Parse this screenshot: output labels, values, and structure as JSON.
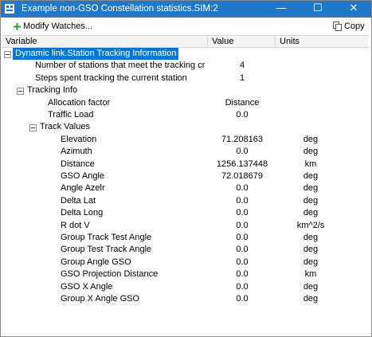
{
  "window": {
    "title": "Example non-GSO Constellation statistics.SIM:2",
    "minimize_glyph": "—",
    "maximize_glyph": "☐",
    "close_glyph": "✕"
  },
  "toolbar": {
    "modify_label": "Modify Watches...",
    "copy_label": "Copy"
  },
  "columns": {
    "variable": "Variable",
    "value": "Value",
    "units": "Units"
  },
  "colors": {
    "titlebar": "#1f79c8",
    "selection": "#0078d7",
    "add_icon": "#2e9b3c"
  },
  "rows": [
    {
      "depth": 0,
      "toggle": true,
      "selected": true,
      "name": "Dynamic link.Station Tracking Information",
      "value": "",
      "units": ""
    },
    {
      "depth": 1,
      "toggle": false,
      "name": "Number of stations that meet the tracking crite...",
      "value": "4",
      "units": ""
    },
    {
      "depth": 1,
      "toggle": false,
      "name": "Steps spent tracking the current station",
      "value": "1",
      "units": ""
    },
    {
      "depth": 1,
      "toggle": true,
      "name": "Tracking Info",
      "value": "",
      "units": ""
    },
    {
      "depth": 2,
      "toggle": false,
      "name": "Allocation factor",
      "value": "Distance",
      "units": ""
    },
    {
      "depth": 2,
      "toggle": false,
      "name": "Traffic Load",
      "value": "0.0",
      "units": ""
    },
    {
      "depth": 2,
      "toggle": true,
      "name": "Track Values",
      "value": "",
      "units": ""
    },
    {
      "depth": 3,
      "toggle": false,
      "name": "Elevation",
      "value": "71.208163",
      "units": "deg"
    },
    {
      "depth": 3,
      "toggle": false,
      "name": "Azimuth",
      "value": "0.0",
      "units": "deg"
    },
    {
      "depth": 3,
      "toggle": false,
      "name": "Distance",
      "value": "1256.137448",
      "units": "km"
    },
    {
      "depth": 3,
      "toggle": false,
      "name": "GSO Angle",
      "value": "72.018679",
      "units": "deg"
    },
    {
      "depth": 3,
      "toggle": false,
      "name": "Angle Azelr",
      "value": "0.0",
      "units": "deg"
    },
    {
      "depth": 3,
      "toggle": false,
      "name": "Delta Lat",
      "value": "0.0",
      "units": "deg"
    },
    {
      "depth": 3,
      "toggle": false,
      "name": "Delta Long",
      "value": "0.0",
      "units": "deg"
    },
    {
      "depth": 3,
      "toggle": false,
      "name": "R dot V",
      "value": "0.0",
      "units": "km^2/s"
    },
    {
      "depth": 3,
      "toggle": false,
      "name": "Group Track Test Angle",
      "value": "0.0",
      "units": "deg"
    },
    {
      "depth": 3,
      "toggle": false,
      "name": "Group Test Track Angle",
      "value": "0.0",
      "units": "deg"
    },
    {
      "depth": 3,
      "toggle": false,
      "name": "Group Angle GSO",
      "value": "0.0",
      "units": "deg"
    },
    {
      "depth": 3,
      "toggle": false,
      "name": "GSO Projection Distance",
      "value": "0.0",
      "units": "km"
    },
    {
      "depth": 3,
      "toggle": false,
      "name": "GSO X Angle",
      "value": "0.0",
      "units": "deg"
    },
    {
      "depth": 3,
      "toggle": false,
      "name": "Group X Angle GSO",
      "value": "0.0",
      "units": "deg"
    }
  ]
}
